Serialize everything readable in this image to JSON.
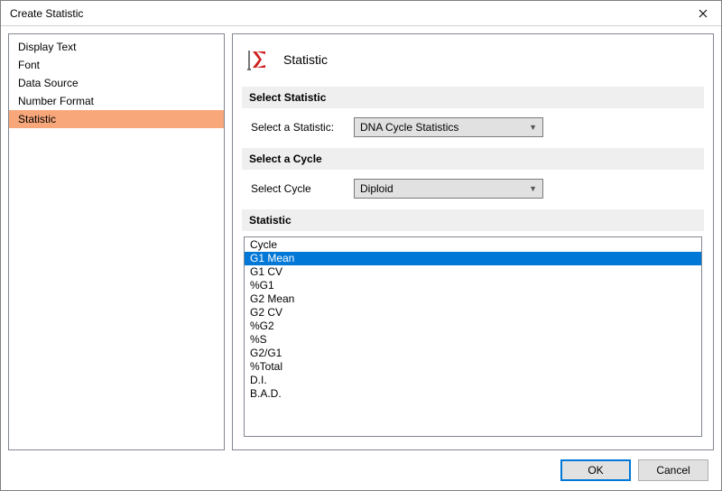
{
  "title": "Create Statistic",
  "sidebar": {
    "items": [
      {
        "label": "Display Text",
        "selected": false
      },
      {
        "label": "Font",
        "selected": false
      },
      {
        "label": "Data Source",
        "selected": false
      },
      {
        "label": "Number Format",
        "selected": false
      },
      {
        "label": "Statistic",
        "selected": true
      }
    ]
  },
  "main": {
    "header": "Statistic",
    "sections": {
      "select_statistic": {
        "heading": "Select Statistic",
        "label": "Select a Statistic:",
        "value": "DNA Cycle Statistics"
      },
      "select_cycle": {
        "heading": "Select a Cycle",
        "label": "Select Cycle",
        "value": "Diploid"
      },
      "statistic_list": {
        "heading": "Statistic",
        "items": [
          {
            "label": "Cycle",
            "selected": false
          },
          {
            "label": "G1 Mean",
            "selected": true
          },
          {
            "label": "G1 CV",
            "selected": false
          },
          {
            "label": "%G1",
            "selected": false
          },
          {
            "label": "G2 Mean",
            "selected": false
          },
          {
            "label": "G2 CV",
            "selected": false
          },
          {
            "label": "%G2",
            "selected": false
          },
          {
            "label": "%S",
            "selected": false
          },
          {
            "label": "G2/G1",
            "selected": false
          },
          {
            "label": "%Total",
            "selected": false
          },
          {
            "label": "D.I.",
            "selected": false
          },
          {
            "label": "B.A.D.",
            "selected": false
          }
        ]
      }
    }
  },
  "footer": {
    "ok": "OK",
    "cancel": "Cancel"
  }
}
